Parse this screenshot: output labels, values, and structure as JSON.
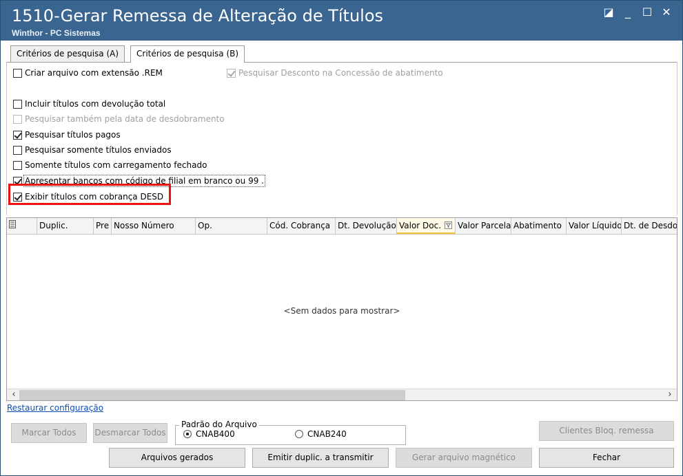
{
  "window": {
    "title": "1510-Gerar Remessa de Alteração de Títulos",
    "subtitle": "Winthor - PC Sistemas",
    "controls": {
      "restore": "◪",
      "minimize": "_",
      "maximize": "☐",
      "close": "✕"
    }
  },
  "tabs": [
    {
      "label": "Critérios de pesquisa (A)",
      "active": false
    },
    {
      "label": "Critérios de pesquisa (B)",
      "active": true
    }
  ],
  "options": {
    "criar_rem": {
      "label": "Criar arquivo com extensão .REM",
      "checked": false,
      "enabled": true
    },
    "pesq_desconto": {
      "label": "Pesquisar Desconto na Concessão de abatimento",
      "checked": true,
      "enabled": false
    },
    "incluir_devolucao": {
      "label": "Incluir títulos com devolução total",
      "checked": false,
      "enabled": true
    },
    "pesq_desdobramento": {
      "label": "Pesquisar também pela data de desdobramento",
      "checked": false,
      "enabled": false
    },
    "pesq_pagos": {
      "label": "Pesquisar títulos pagos",
      "checked": true,
      "enabled": true
    },
    "somente_enviados": {
      "label": "Pesquisar somente títulos enviados",
      "checked": false,
      "enabled": true
    },
    "carregamento_fechado": {
      "label": "Somente títulos com carregamento fechado",
      "checked": false,
      "enabled": true
    },
    "bancos_filial": {
      "label": "Apresentar bancos com código de filial em branco ou 99 .",
      "checked": true,
      "enabled": true
    },
    "cobranca_desd": {
      "label": "Exibir títulos com cobrança DESD",
      "checked": true,
      "enabled": true
    }
  },
  "grid": {
    "columns": [
      "Duplic.",
      "Pre",
      "Nosso Número",
      "Op.",
      "Cód. Cobrança",
      "Dt. Devolução",
      "Valor Doc.",
      "Valor Parcela",
      "Abatimento",
      "Valor Líquido",
      "Dt. de Desdo"
    ],
    "empty_text": "<Sem dados para mostrar>",
    "selector_icon": "column-chooser-icon",
    "filter_icon": "filter-dropdown-icon",
    "scroll_left": "‹",
    "scroll_right": "›"
  },
  "footer": {
    "restore_link": "Restaurar configuração",
    "marcar_todos": "Marcar Todos",
    "desmarcar_todos": "Desmarcar Todos",
    "padrao_legend": "Padrão do Arquivo",
    "radio_cnab400": "CNAB400",
    "radio_cnab240": "CNAB240",
    "selected_format": "CNAB400",
    "clientes_bloq": "Clientes Bloq. remessa",
    "arquivos_gerados": "Arquivos gerados",
    "emitir_duplic": "Emitir duplic. a transmitir",
    "gerar_arquivo": "Gerar arquivo magnético",
    "fechar": "Fechar"
  }
}
